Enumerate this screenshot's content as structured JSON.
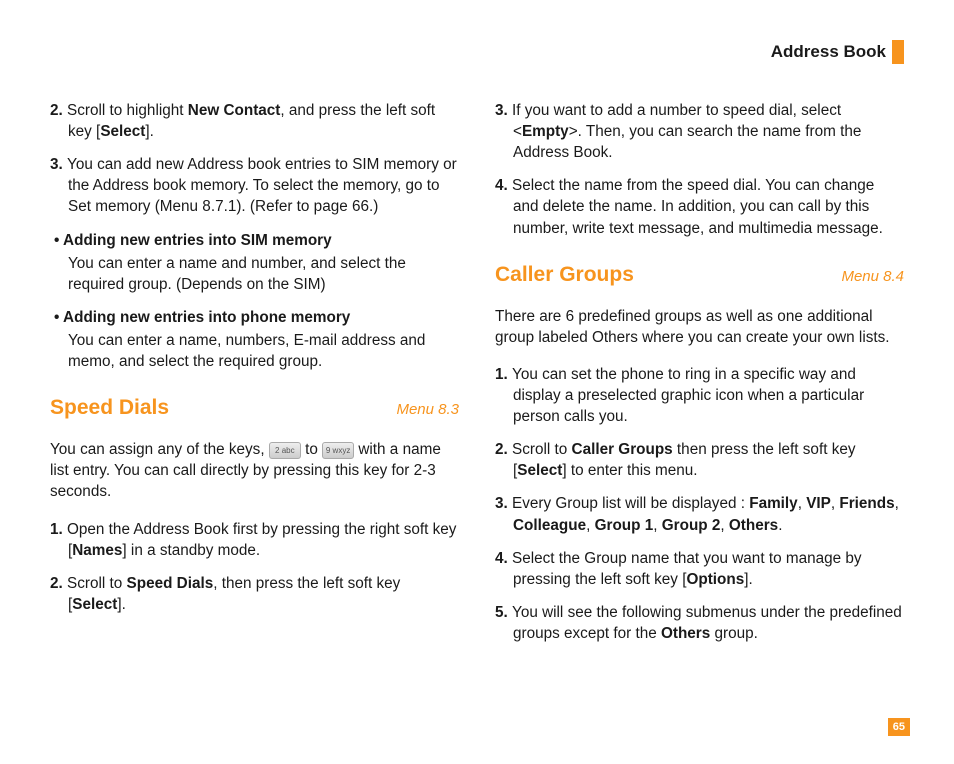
{
  "header": {
    "title": "Address Book"
  },
  "left": {
    "step2_pre": "Scroll to highlight ",
    "step2_bold": "New Contact",
    "step2_mid": ", and press the left soft key [",
    "step2_select": "Select",
    "step2_end": "].",
    "step3": "You can add new Address book entries to SIM memory or the Address book memory. To select the memory, go to Set memory (Menu 8.7.1). (Refer to page 66.)",
    "bullet1": "Adding new entries into SIM memory",
    "sub1": "You can enter a name and number, and select the required group. (Depends on the SIM)",
    "bullet2": "Adding new entries into phone memory",
    "sub2": "You can enter a name, numbers, E-mail address and memo, and select the required group.",
    "speed": {
      "title": "Speed Dials",
      "menu": "Menu 8.3"
    },
    "speed_intro_pre": "You can assign any of the keys, ",
    "key_from": "2 abc",
    "speed_intro_mid": " to ",
    "key_to": "9 wxyz",
    "speed_intro_post": " with a name list entry. You can call directly by pressing this key for 2-3 seconds.",
    "speed1_pre": "Open the Address Book first by pressing the right soft key [",
    "speed1_names": "Names",
    "speed1_end": "] in a standby mode.",
    "speed2_pre": "Scroll to ",
    "speed2_b": "Speed Dials",
    "speed2_mid": ", then press the left soft key [",
    "speed2_select": "Select",
    "speed2_end": "]."
  },
  "right": {
    "step3_pre": "If you want to add a number to speed dial, select <",
    "step3_empty": "Empty",
    "step3_post": ">. Then, you can search the name from the Address Book.",
    "step4": "Select the name from the speed dial. You can change and delete the name. In addition, you can call by this number, write text message, and multimedia message.",
    "caller": {
      "title": "Caller Groups",
      "menu": "Menu 8.4"
    },
    "caller_intro": "There are 6 predefined groups as well as one additional group labeled Others where you can create your own lists.",
    "c1": "You can set the phone to ring in a specific way and display a preselected graphic icon when a particular person calls you.",
    "c2_pre": "Scroll to ",
    "c2_b": "Caller Groups",
    "c2_mid": " then press the left soft key [",
    "c2_select": "Select",
    "c2_end": "] to enter this menu.",
    "c3_pre": "Every Group list will be displayed : ",
    "c3_family": "Family",
    "c3_sep": ", ",
    "c3_vip": "VIP",
    "c3_friends": "Friends",
    "c3_colleague": "Colleague",
    "c3_g1": "Group 1",
    "c3_g2": "Group 2",
    "c3_others": "Others",
    "c3_end": ".",
    "c4_pre": "Select the Group name that you want to manage by pressing the left soft key [",
    "c4_options": "Options",
    "c4_end": "].",
    "c5_pre": "You will see the following submenus under the predefined groups except for the ",
    "c5_others": "Others",
    "c5_end": " group."
  },
  "page_number": "65"
}
